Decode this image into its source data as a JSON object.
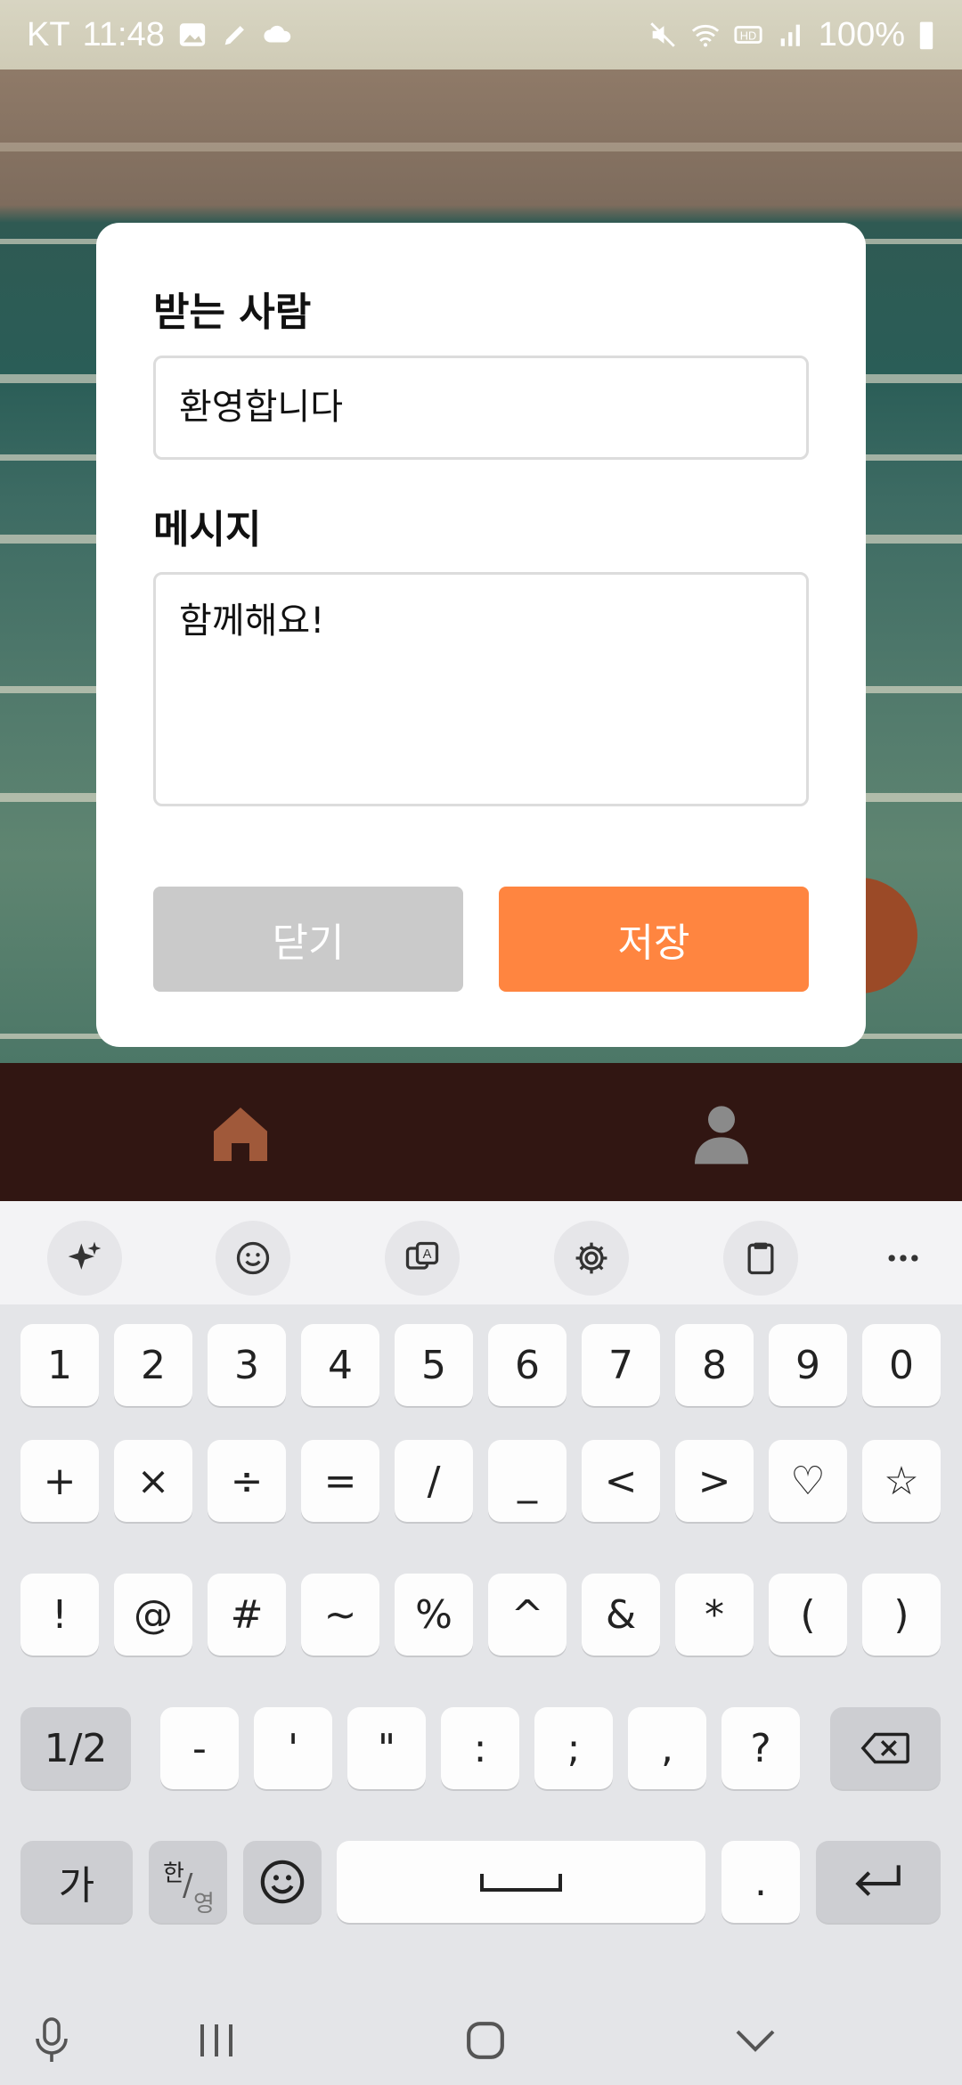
{
  "status_bar": {
    "carrier": "KT",
    "time": "11:48",
    "battery": "100%"
  },
  "dialog": {
    "recipient_label": "받는 사람",
    "recipient_value": "환영합니다",
    "message_label": "메시지",
    "message_value": "함께해요!",
    "close_label": "닫기",
    "save_label": "저장"
  },
  "bottom_nav": {
    "items": [
      "home-icon",
      "person-icon"
    ]
  },
  "keyboard": {
    "toolbar_icons": [
      "sparkle-icon",
      "emoji-icon",
      "translate-icon",
      "gear-icon",
      "clipboard-icon",
      "more-icon"
    ],
    "row1": [
      "1",
      "2",
      "3",
      "4",
      "5",
      "6",
      "7",
      "8",
      "9",
      "0"
    ],
    "row2": [
      "+",
      "×",
      "÷",
      "=",
      "/",
      "_",
      "<",
      ">",
      "♡",
      "☆"
    ],
    "row3": [
      "!",
      "@",
      "#",
      "~",
      "%",
      "^",
      "&",
      "*",
      "(",
      ")"
    ],
    "row4": {
      "page": "1/2",
      "keys": [
        "-",
        "'",
        "\"",
        ":",
        ";",
        ",",
        "?"
      ]
    },
    "row5": {
      "lang": "가",
      "han_top": "한",
      "han_bottom": "영",
      "period": "."
    }
  },
  "colors": {
    "accent": "#ff8540",
    "close_button": "#cacaca",
    "navbar": "#311612",
    "home_icon": "#a0593a"
  }
}
